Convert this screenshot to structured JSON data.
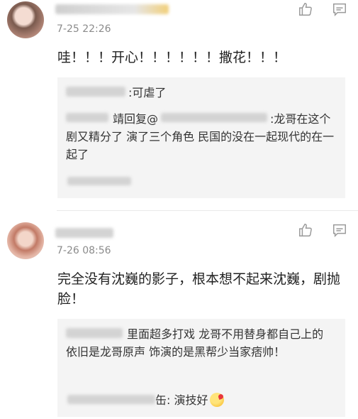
{
  "comments": [
    {
      "time": "7-25 22:26",
      "text": "哇！！！开心！！！！！！撒花！！！",
      "replies": [
        {
          "text": ":可虐了"
        },
        {
          "mention_prefix": "回复@",
          "text": ":龙哥在这个剧又精分了  演了三个角色  民国的没在一起现代的在一起了"
        }
      ]
    },
    {
      "time": "7-26 08:56",
      "text": "完全没有沈巍的影子，根本想不起来沈巍，剧抛脸！",
      "replies": [
        {
          "text": "里面超多打戏  龙哥不用替身都自己上的  依旧是龙哥原声   饰演的是黑帮少当家痞帅！"
        },
        {
          "text": ": 演技好"
        }
      ]
    }
  ],
  "icons": {
    "like": "thumbs-up-icon",
    "reply": "comment-icon",
    "emoji": "kiss-face-emoji"
  }
}
